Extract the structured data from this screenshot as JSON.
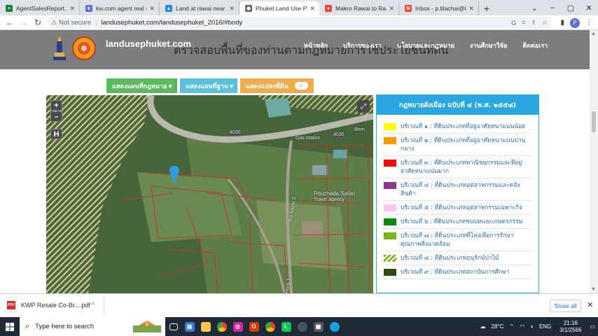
{
  "browser": {
    "tabs": [
      {
        "title": "AgentSalesReport.xlsx",
        "favicon_color": "#188038",
        "favicon_glyph": "+",
        "active": false
      },
      {
        "title": "kw.com agent real esta",
        "favicon_color": "#5e6ad2",
        "favicon_glyph": "k",
        "active": false
      },
      {
        "title": "Land at rawai near Te",
        "favicon_color": "#1e88e5",
        "favicon_glyph": "▲",
        "active": false
      },
      {
        "title": "Phuket Land Use Polic",
        "favicon_color": "#5f6368",
        "favicon_glyph": "◉",
        "active": true
      },
      {
        "title": "Makro Rawai to Rawai",
        "favicon_color": "#ea4335",
        "favicon_glyph": "●",
        "active": false
      },
      {
        "title": "Inbox - p.tilachai@kw",
        "favicon_color": "#ea4335",
        "favicon_glyph": "M",
        "active": false
      }
    ],
    "new_tab": "+",
    "security_label": "Not secure",
    "url": "landusephuket.com/landusephuket_2016/#body",
    "profile_initial": "P"
  },
  "site": {
    "title": "landusephuket.com",
    "headline": "ตรวจสอบพื้นที่ของท่านตามกฎหมายการใช้ประโยชน์ที่ดิน",
    "nav": [
      "หน้าหลัก",
      "บริการของเรา",
      "นโยบายและกฎหมาย",
      "งานศึกษาวิจัย",
      "ติดต่อเรา"
    ]
  },
  "buttons": {
    "legal_map": "แสดงแผนที่กฎหมาย ▾",
    "base_map": "แสดงแผนที่ฐาน ▾",
    "parcels": "แสดงแปลงที่ดิน",
    "parcels_toggle": "✓"
  },
  "map": {
    "zoom_in": "+",
    "zoom_out": "–",
    "home": "H",
    "expand": "⤢",
    "labels": {
      "gas_station": "Gas station",
      "road_4030_a": "4030",
      "road_4030_b": "4030",
      "phuchada": "Phuchada Safari",
      "travel": "Travel agency",
      "soi_nayai_1": "Soi Nayai 3",
      "soi_nayai_2": "Soi Nayai 3",
      "bern": "Bern"
    },
    "colors": {
      "vegetation": "#3f5c32",
      "road": "#b9b9ad",
      "parcel_line": "#c0392b",
      "hatch": "#d9c9a8",
      "pin": "#2d9be0"
    }
  },
  "legend": {
    "title": "กฎหมายผังเมือง ฉบับที่ ๔ (พ.ศ. ๒๕๕๘)",
    "items": [
      {
        "color": "#ffff00",
        "label": "บริเวณที่ ๑ : ที่ดินประเภทที่อยู่อาศัยหนาแน่นน้อย"
      },
      {
        "color": "#ff9900",
        "label": "บริเวณที่ ๒ : ที่ดินประเภทที่อยู่อาศัยหนาแน่นปานกลาง"
      },
      {
        "color": "#ff0000",
        "label": "บริเวณที่ ๓ : ที่ดินประเภทพาณิชยกรรมและที่อยู่อาศัยหนาแน่นมาก"
      },
      {
        "color": "#8b3a8b",
        "label": "บริเวณที่ ๔ : ที่ดินประเภทอุตสาหกรรมและคลังสินค้า"
      },
      {
        "color": "#f7c8f0",
        "label": "บริเวณที่ ๕ : ที่ดินประเภทอุตสาหกรรมเฉพาะกิจ"
      },
      {
        "color": "#0a8a0a",
        "label": "บริเวณที่ ๖ : ที่ดินประเภทชนบทและเกษตรกรรม"
      },
      {
        "color": "#7cb518",
        "label": "บริเวณที่ ๗ : ที่ดินประเภทที่โล่งเพื่อการรักษาคุณภาพสิ่งแวดล้อม"
      },
      {
        "color": "hatch-green",
        "label": "บริเวณที่ ๘ : ที่ดินประเภทอนุรักษ์ป่าไม้"
      },
      {
        "color": "#2f4a14",
        "label": "บริเวณที่ ๙ : ที่ดินประเภทสถาบันการศึกษา"
      }
    ]
  },
  "downloads": {
    "file": "KWP Resale Co-Br....pdf",
    "caret": "^",
    "show_all": "Show all",
    "close": "✕"
  },
  "taskbar": {
    "search_placeholder": "Type here to search",
    "weather": "28°C",
    "lang": "ENG",
    "time": "21:16",
    "date": "3/1/2566"
  }
}
